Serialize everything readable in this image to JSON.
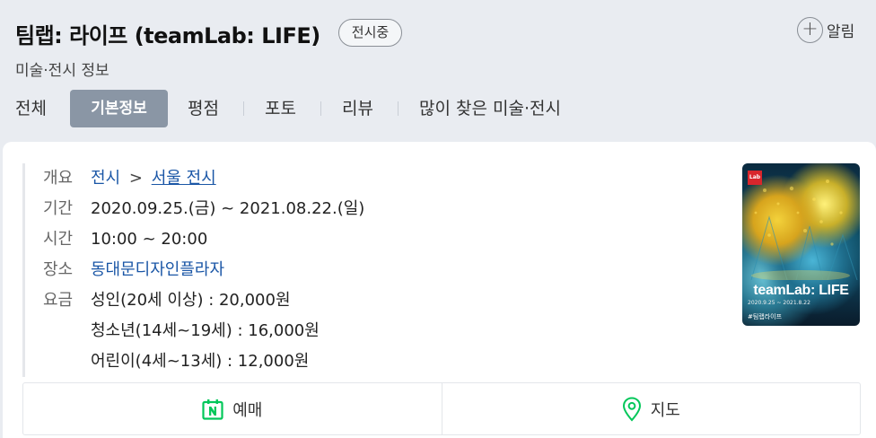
{
  "header": {
    "title": "팀랩: 라이프 (teamLab: LIFE)",
    "status_badge": "전시중",
    "alarm_label": "알림",
    "category": "미술·전시 정보"
  },
  "tabs": [
    {
      "label": "전체",
      "active": false
    },
    {
      "label": "기본정보",
      "active": true
    },
    {
      "label": "평점",
      "active": false
    },
    {
      "label": "포토",
      "active": false
    },
    {
      "label": "리뷰",
      "active": false
    },
    {
      "label": "많이 찾은 미술·전시",
      "active": false
    }
  ],
  "info": {
    "overview": {
      "key": "개요",
      "category1": "전시",
      "separator": ">",
      "category2": "서울 전시"
    },
    "period": {
      "key": "기간",
      "value": "2020.09.25.(금) ~ 2021.08.22.(일)"
    },
    "time": {
      "key": "시간",
      "value": "10:00 ~ 20:00"
    },
    "place": {
      "key": "장소",
      "value": "동대문디자인플라자"
    },
    "fee": {
      "key": "요금",
      "items": [
        "성인(20세 이상) : 20,000원",
        "청소년(14세~19세) : 16,000원",
        "어린이(4세~13세) : 12,000원"
      ]
    }
  },
  "poster": {
    "logo": "Lab",
    "brand": "teamLab: LIFE",
    "dates": "2020.9.25 ~ 2021.8.22",
    "tag": "#팀랩라이프"
  },
  "actions": {
    "booking_label": "예매",
    "map_label": "지도"
  },
  "colors": {
    "page_bg": "#e9ecf1",
    "active_tab": "#8a96a5",
    "link": "#1a56a6",
    "naver_green": "#03c75a"
  }
}
